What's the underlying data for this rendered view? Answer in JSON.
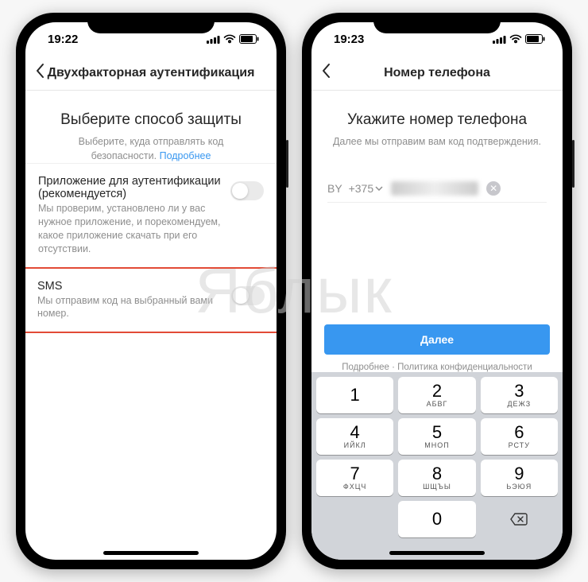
{
  "watermark": "Яблык",
  "left": {
    "time": "19:22",
    "nav_title": "Двухфакторная аутентификация",
    "heading": "Выберите способ защиты",
    "subheading": "Выберите, куда отправлять код безопасности.",
    "learn_more": "Подробнее",
    "option_app": {
      "title": "Приложение для аутентификации (рекомендуется)",
      "desc": "Мы проверим, установлено ли у вас нужное приложение, и порекомендуем, какое приложение скачать при его отсутствии."
    },
    "option_sms": {
      "title": "SMS",
      "desc": "Мы отправим код на выбранный вами номер."
    }
  },
  "right": {
    "time": "19:23",
    "nav_title": "Номер телефона",
    "heading": "Укажите номер телефона",
    "subheading": "Далее мы отправим вам код подтверждения.",
    "country_code": "BY",
    "dial_code": "+375",
    "next_button": "Далее",
    "footer": "Подробнее · Политика конфиденциальности",
    "keypad": [
      {
        "d": "1",
        "l": ""
      },
      {
        "d": "2",
        "l": "АБВГ"
      },
      {
        "d": "3",
        "l": "ДЕЖЗ"
      },
      {
        "d": "4",
        "l": "ИЙКЛ"
      },
      {
        "d": "5",
        "l": "МНОП"
      },
      {
        "d": "6",
        "l": "РСТУ"
      },
      {
        "d": "7",
        "l": "ФХЦЧ"
      },
      {
        "d": "8",
        "l": "ШЩЪЫ"
      },
      {
        "d": "9",
        "l": "ЬЭЮЯ"
      }
    ],
    "zero": "0"
  }
}
